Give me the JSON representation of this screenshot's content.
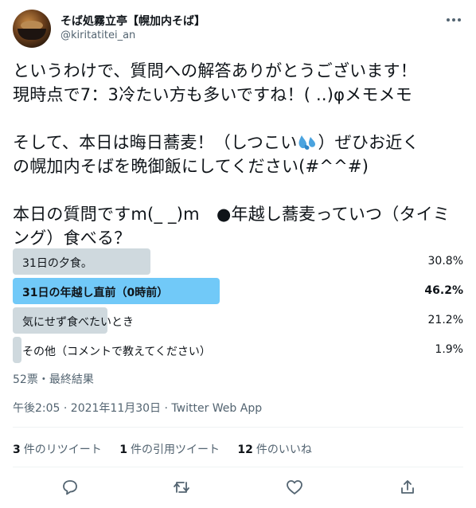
{
  "user": {
    "display_name": "そば処霧立亭【幌加内そば】",
    "handle": "@kiritatitei_an"
  },
  "tweet": {
    "text": "というわけで、質問への解答ありがとうございます！\n現時点で7：3冷たい方も多いですね！( ..)φメモメモ\n\nそして、本日は晦日蕎麦！（しつこい",
    "text_after_emoji": "）ぜひお近く\nの幌加内そばを晩御飯にしてください(#^^#)\n\n本日の質問ですm(_ _)m　●年越し蕎麦っていつ（タイミング）食べる？"
  },
  "poll": {
    "options": [
      {
        "label": "31日の夕食。",
        "percent": "30.8%",
        "value": 30.8,
        "winner": false
      },
      {
        "label": "31日の年越し直前（0時前）",
        "percent": "46.2%",
        "value": 46.2,
        "winner": true
      },
      {
        "label": "気にせず食べたいとき",
        "percent": "21.2%",
        "value": 21.2,
        "winner": false
      },
      {
        "label": "その他（コメントで教えてください）",
        "percent": "1.9%",
        "value": 1.9,
        "winner": false
      }
    ],
    "meta": "52票・最終結果"
  },
  "timestamp": "午後2:05 · 2021年11月30日 · Twitter Web App",
  "stats": {
    "retweets": {
      "count": "3",
      "label": "件のリツイート"
    },
    "quotes": {
      "count": "1",
      "label": "件の引用ツイート"
    },
    "likes": {
      "count": "12",
      "label": "件のいいね"
    }
  },
  "colors": {
    "winner_bar": "#71c9f8",
    "bar": "#cfd9de",
    "secondary_text": "#536471"
  },
  "icons": [
    "more-icon",
    "sweat-emoji-icon",
    "reply-icon",
    "retweet-icon",
    "like-icon",
    "share-icon"
  ]
}
